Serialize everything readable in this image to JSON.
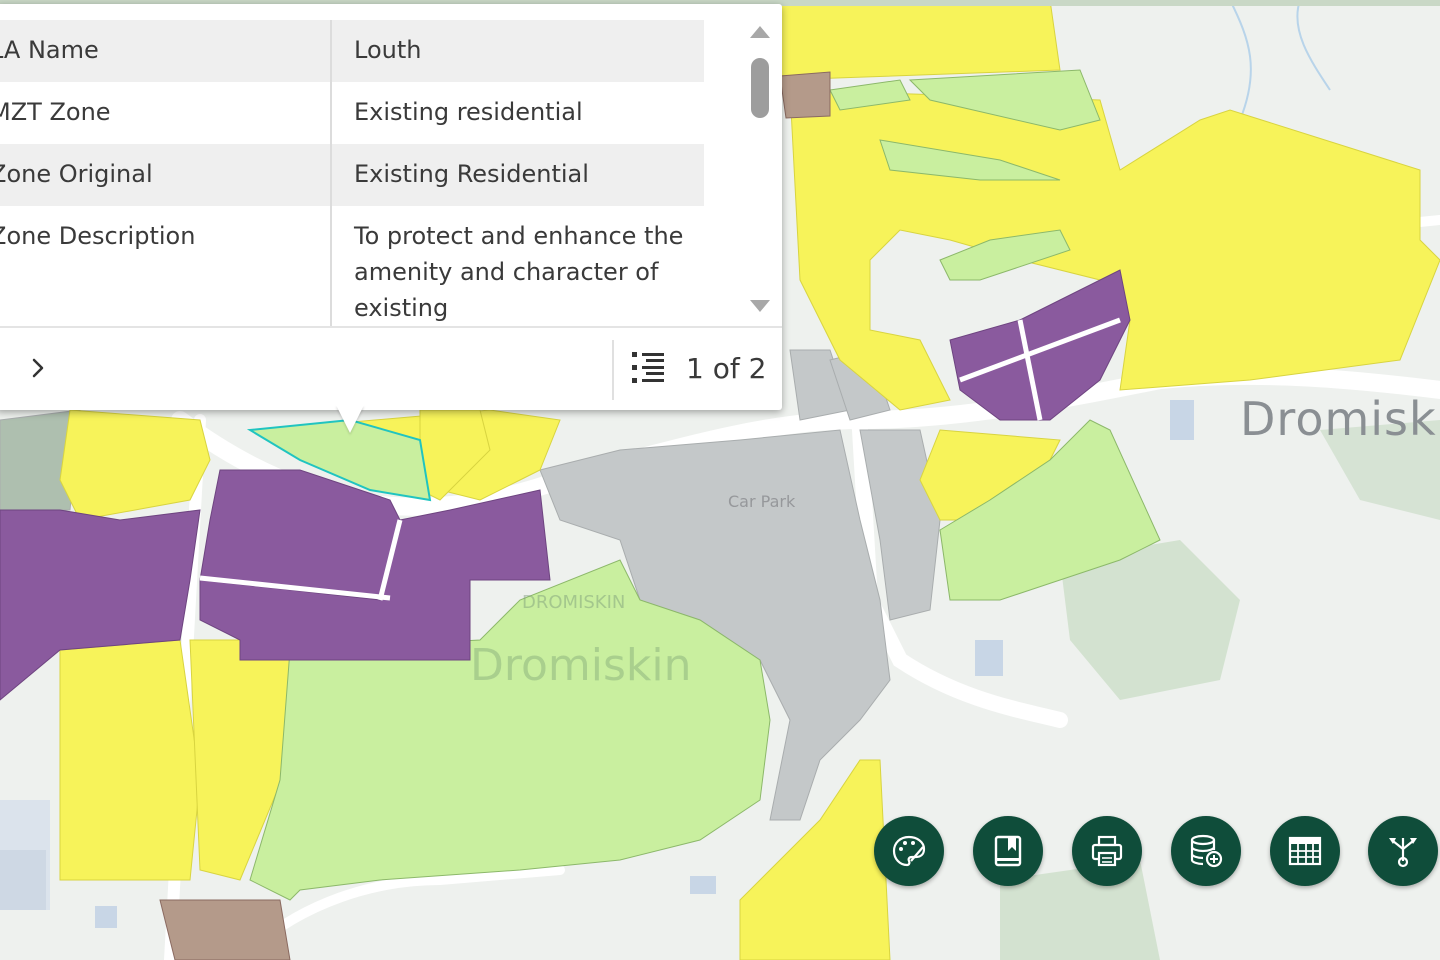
{
  "popup": {
    "rows": [
      {
        "key": "LA Name",
        "value": "Louth"
      },
      {
        "key": "MZT Zone",
        "value": "Existing residential"
      },
      {
        "key": "Zone Original",
        "value": "Existing Residential"
      },
      {
        "key": "Zone Description",
        "value": "To protect and enhance the amenity and character of existing"
      }
    ],
    "feature_count": "1 of 2"
  },
  "map": {
    "place_name": "Dromiskin",
    "place_name_faded": "Dromiskin",
    "car_park_label": "Car Park",
    "small_place_label": "DROMISKIN",
    "zone_colors": {
      "residential": "#f7f35a",
      "open_space": "#c9ef9f",
      "community": "#8a5a9e",
      "town_centre": "#c4c8c9",
      "industry": "#b49a8a",
      "buffer_green": "#a8c8a8"
    }
  },
  "toolbar": {
    "button_color": "#0f4d3a",
    "buttons": [
      {
        "name": "basemap-gallery-button",
        "icon": "palette-icon"
      },
      {
        "name": "bookmarks-button",
        "icon": "bookmark-icon"
      },
      {
        "name": "print-button",
        "icon": "printer-icon"
      },
      {
        "name": "add-data-button",
        "icon": "database-add-icon"
      },
      {
        "name": "attribute-table-button",
        "icon": "table-icon"
      },
      {
        "name": "share-button",
        "icon": "share-icon"
      }
    ]
  }
}
